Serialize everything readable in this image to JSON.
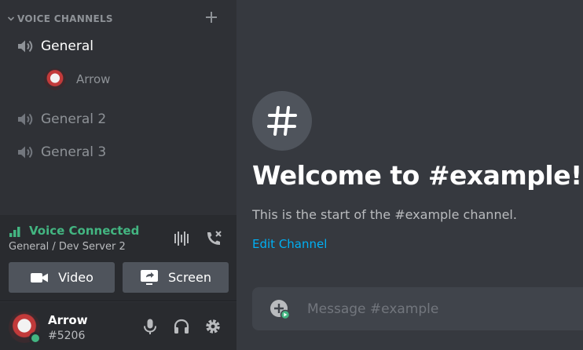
{
  "sidebar": {
    "section_title": "VOICE CHANNELS",
    "channels": [
      {
        "name": "General",
        "active": true
      },
      {
        "name": "General 2",
        "active": false
      },
      {
        "name": "General 3",
        "active": false
      }
    ],
    "voice_user": "Arrow"
  },
  "voice_panel": {
    "status": "Voice Connected",
    "location": "General / Dev Server 2",
    "video_label": "Video",
    "screen_label": "Screen"
  },
  "user_panel": {
    "username": "Arrow",
    "tag": "#5206"
  },
  "main": {
    "welcome_title": "Welcome to #example!",
    "start_text": "This is the start of the #example channel.",
    "edit_link": "Edit Channel",
    "message_placeholder": "Message #example"
  },
  "colors": {
    "sidebar_bg": "#2f3136",
    "main_bg": "#36393f",
    "panel_bg": "#292b2f",
    "connected_green": "#43b581",
    "link_blue": "#00b0f4"
  }
}
